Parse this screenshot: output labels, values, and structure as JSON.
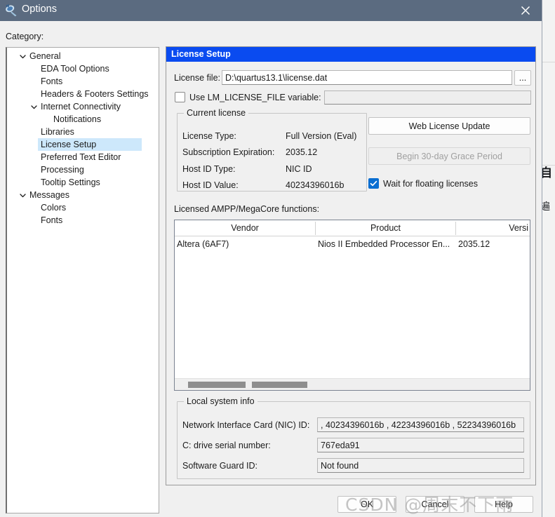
{
  "window": {
    "title": "Options",
    "icon": "quartus-app-icon",
    "close_label": "✕"
  },
  "category": {
    "label": "Category:",
    "tree": [
      {
        "label": "General",
        "indent": 0,
        "chevron": "expanded",
        "selected": false
      },
      {
        "label": "EDA Tool Options",
        "indent": 1,
        "chevron": "none",
        "selected": false
      },
      {
        "label": "Fonts",
        "indent": 1,
        "chevron": "none",
        "selected": false
      },
      {
        "label": "Headers & Footers Settings",
        "indent": 1,
        "chevron": "none",
        "selected": false
      },
      {
        "label": "Internet Connectivity",
        "indent": 1,
        "chevron": "expanded",
        "selected": false
      },
      {
        "label": "Notifications",
        "indent": 2,
        "chevron": "none",
        "selected": false
      },
      {
        "label": "Libraries",
        "indent": 1,
        "chevron": "none",
        "selected": false
      },
      {
        "label": "License Setup",
        "indent": 1,
        "chevron": "none",
        "selected": true
      },
      {
        "label": "Preferred Text Editor",
        "indent": 1,
        "chevron": "none",
        "selected": false
      },
      {
        "label": "Processing",
        "indent": 1,
        "chevron": "none",
        "selected": false
      },
      {
        "label": "Tooltip Settings",
        "indent": 1,
        "chevron": "none",
        "selected": false
      },
      {
        "label": "Messages",
        "indent": 0,
        "chevron": "expanded",
        "selected": false
      },
      {
        "label": "Colors",
        "indent": 1,
        "chevron": "none",
        "selected": false
      },
      {
        "label": "Fonts",
        "indent": 1,
        "chevron": "none",
        "selected": false
      }
    ]
  },
  "pane": {
    "header": "License Setup",
    "license_file": {
      "label": "License file:",
      "value": "D:\\quartus13.1\\license.dat",
      "placeholder": "",
      "browse_label": "..."
    },
    "lm_license": {
      "checkbox_label": "Use LM_LICENSE_FILE variable:",
      "checked": false,
      "value": "",
      "placeholder": ""
    },
    "current_license": {
      "title": "Current license",
      "rows": [
        {
          "label": "License Type:",
          "value": "Full Version (Eval)"
        },
        {
          "label": "Subscription Expiration:",
          "value": "2035.12"
        },
        {
          "label": "Host ID Type:",
          "value": "NIC ID"
        },
        {
          "label": "Host ID Value:",
          "value": "40234396016b"
        }
      ]
    },
    "web_license_update_label": "Web License Update",
    "grace_period_label": "Begin 30-day Grace Period",
    "grace_period_enabled": false,
    "wait_floating": {
      "label": "Wait for floating licenses",
      "checked": true
    },
    "functions": {
      "label": "Licensed AMPP/MegaCore functions:",
      "columns": [
        "Vendor",
        "Product",
        "Versi"
      ],
      "rows": [
        {
          "vendor": "Altera (6AF7)",
          "product": "Nios II Embedded Processor En...",
          "version": "2035.12"
        }
      ]
    },
    "local_system_info": {
      "title": "Local system info",
      "rows": [
        {
          "label": "Network Interface Card (NIC) ID:",
          "value": ", 40234396016b , 42234396016b , 52234396016b"
        },
        {
          "label": "C: drive serial number:",
          "value": "767eda91"
        },
        {
          "label": "Software Guard ID:",
          "value": "Not found"
        }
      ]
    }
  },
  "footer": {
    "ok_label": "OK",
    "cancel_label": "Cancel",
    "help_label": "Help"
  },
  "watermark": {
    "text": "CSDN @周末不下雨"
  },
  "background_window": {
    "fragment_top": "自",
    "fragment_bottom": "遍"
  },
  "colors": {
    "titlebar": "#5b6b80",
    "pane_header": "#0a4bf0",
    "selection": "#cde8fb",
    "checkbox_on": "#0a6ed1",
    "dialog_bg": "#f0f0f0"
  }
}
